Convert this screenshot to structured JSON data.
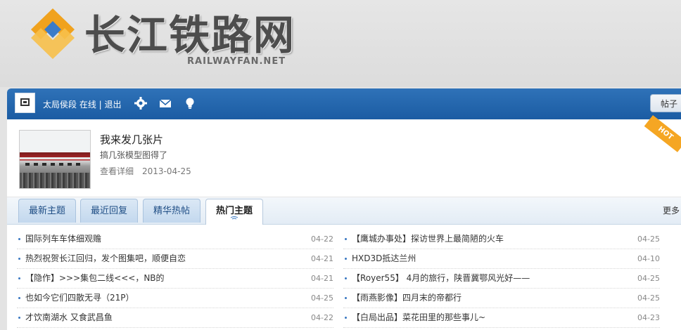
{
  "site": {
    "name": "长江铁路网",
    "domain": "RAILWAYFAN.NET"
  },
  "topbar": {
    "user_text": "太局侯段 在线 | 退出",
    "icons": [
      "gear-icon",
      "mail-icon",
      "lightbulb-icon"
    ],
    "search_tab": "帖子"
  },
  "featured": {
    "title": "我来发几张片",
    "subtitle": "搞几张模型图得了",
    "link": "查看详细",
    "date": "2013-04-25",
    "ribbon": "HOT"
  },
  "tabs": [
    {
      "label": "最新主题"
    },
    {
      "label": "最近回复"
    },
    {
      "label": "精华热帖"
    },
    {
      "label": "热门主题"
    }
  ],
  "more": "更多",
  "left_list": [
    {
      "title": "国际列车车体细观赡",
      "date": "04-22"
    },
    {
      "title": "热烈祝贺长江回归，发个图集吧，顺便自恋",
      "date": "04-21"
    },
    {
      "title": "【隐作】>>>集包二线<<<，NB的",
      "date": "04-21"
    },
    {
      "title": "也如今它们四散无寻（21P）",
      "date": "04-25"
    },
    {
      "title": "才饮南湖水 又食武昌鱼",
      "date": "04-22"
    }
  ],
  "right_list": [
    {
      "title": "【鹰城办事处】探访世界上最简陋的火车",
      "date": "04-25"
    },
    {
      "title": "HXD3D抵达兰州",
      "date": "04-10"
    },
    {
      "title": "【Royer55】 4月的旅行，陕晋冀鄂风光好——",
      "date": "04-25"
    },
    {
      "title": "【雨燕影像】四月末的帝都行",
      "date": "04-25"
    },
    {
      "title": "【白局出品】菜花田里的那些事儿~",
      "date": "04-23"
    }
  ],
  "colors": {
    "topbar_blue": "#1f63ab",
    "logo_orange": "#f0a21e",
    "link_blue": "#1f4e85"
  }
}
